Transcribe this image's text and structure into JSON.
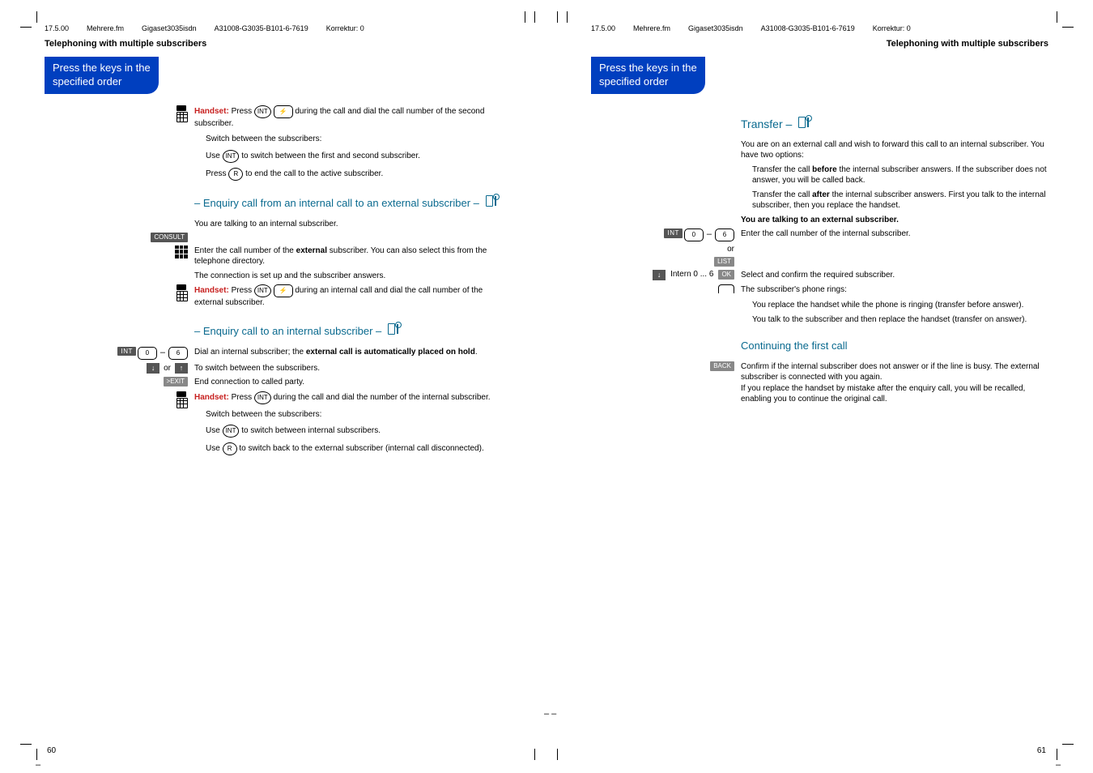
{
  "header": {
    "date": "17.5.00",
    "file": "Mehrere.fm",
    "product": "Gigaset3035isdn",
    "doc": "A31008-G3035-B101-6-7619",
    "korr": "Korrektur: 0"
  },
  "left": {
    "section_title": "Telephoning with multiple subscribers",
    "pill_line1": "Press the keys in the",
    "pill_line2": "specified order",
    "handset_label": "Handset:",
    "t1a": "Press",
    "t1b": "during the call and dial the",
    "t1c": "call number of the second subscriber.",
    "t2": "Switch between the subscribers:",
    "t3a": "Use",
    "t3b": "to switch between the first and second subscriber.",
    "t4a": "Press",
    "t4b": "to end the call to the active subscriber.",
    "h1": "Enquiry call from an internal call to an external subscriber –",
    "t5": "You are talking to an internal subscriber.",
    "consult": "CONSULT",
    "t6a": "Enter the call number of the",
    "t6b": "external",
    "t6c": "subscriber. You can also select this from the telephone directory.",
    "t7": "The connection is set up and the subscriber answers.",
    "t8a": "Press",
    "t8b": "during an internal call and dial the call number of the external subscriber.",
    "h2": "Enquiry call to an internal subscriber –",
    "int": "INT",
    "key0": "0",
    "key6": "6",
    "t9a": "Dial an internal subscriber; the",
    "t9b": "external call is automatically placed on hold",
    "t9c": ".",
    "or": "or",
    "t10": "To switch between the subscribers.",
    "exit": ">EXIT",
    "t11": "End connection to called party.",
    "t12a": "Press",
    "t12b": "during the call and dial the number of the internal subscriber.",
    "t13": "Switch between the subscribers:",
    "t14a": "Use",
    "t14b": "to switch between internal subscribers.",
    "t15a": "Use",
    "t15b": "to switch back to the external subscriber (internal call disconnected).",
    "page_num": "60",
    "int_key": "INT",
    "r_key": "R"
  },
  "right": {
    "section_title": "Telephoning with multiple subscribers",
    "pill_line1": "Press the keys in the",
    "pill_line2": "specified order",
    "h_transfer": "Transfer –",
    "p1": "You are on an external call and wish to forward this call to an internal subscriber. You have two options:",
    "p2a": "Transfer the call",
    "p2b": "before",
    "p2c": "the internal subscriber answers. If the subscriber does not answer, you will be called back.",
    "p3a": "Transfer the call",
    "p3b": "after",
    "p3c": "the internal subscriber answers. First you talk to the internal subscriber, then you replace the handset.",
    "p_bold": "You are talking to an external subscriber.",
    "int": "INT",
    "key0": "0",
    "key6": "6",
    "t_enter": "Enter the call number of the internal subscriber.",
    "or": "or",
    "list": "LIST",
    "intern": "Intern 0 ... 6",
    "ok": "OK",
    "t_select": "Select and confirm the required subscriber.",
    "t_rings": "The subscriber's phone rings:",
    "t_replace1": "You replace the handset while the phone is ringing (transfer before answer).",
    "t_replace2": "You talk to the subscriber and then replace the handset (transfer on answer).",
    "h_cont": "Continuing the first call",
    "back": "BACK",
    "t_back": "Confirm if the internal subscriber does not answer or if the line is busy. The external subscriber is connected with you again.",
    "t_back2": "If you replace the handset by mistake after the enquiry call, you will be recalled, enabling you to continue the original call.",
    "page_num": "61"
  }
}
